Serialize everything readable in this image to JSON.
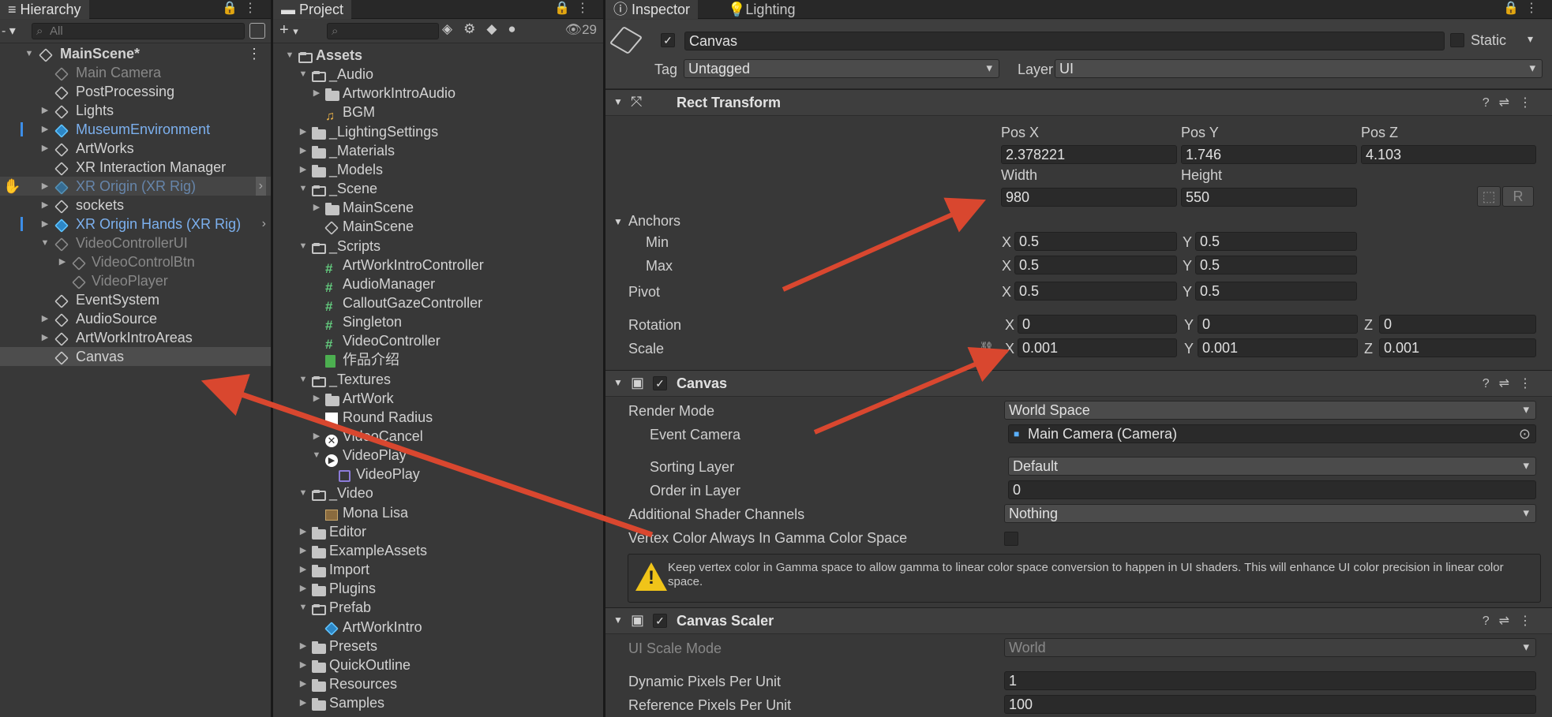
{
  "hierarchy": {
    "tab": "Hierarchy",
    "search_placeholder": "All",
    "scene": "MainScene*",
    "items": [
      "Main Camera",
      "PostProcessing",
      "Lights",
      "MuseumEnvironment",
      "ArtWorks",
      "XR Interaction Manager",
      "XR Origin (XR Rig)",
      "sockets",
      "XR Origin Hands (XR Rig)",
      "VideoControllerUI",
      "VideoControlBtn",
      "VideoPlayer",
      "EventSystem",
      "AudioSource",
      "ArtWorkIntroAreas",
      "Canvas"
    ]
  },
  "project": {
    "tab": "Project",
    "count": "29",
    "items": [
      "Assets",
      "_Audio",
      "ArtworkIntroAudio",
      "BGM",
      "_LightingSettings",
      "_Materials",
      "_Models",
      "_Scene",
      "MainScene",
      "MainScene",
      "_Scripts",
      "ArtWorkIntroController",
      "AudioManager",
      "CalloutGazeController",
      "Singleton",
      "VideoController",
      "作品介绍",
      "_Textures",
      "ArtWork",
      "Round Radius",
      "VideoCancel",
      "VideoPlay",
      "VideoPlay",
      "_Video",
      "Mona Lisa",
      "Editor",
      "ExampleAssets",
      "Import",
      "Plugins",
      "Prefab",
      "ArtWorkIntro",
      "Presets",
      "QuickOutline",
      "Resources",
      "Samples"
    ]
  },
  "inspector": {
    "tabs": [
      "Inspector",
      "Lighting"
    ],
    "object_name": "Canvas",
    "static_label": "Static",
    "tag_label": "Tag",
    "tag_value": "Untagged",
    "layer_label": "Layer",
    "layer_value": "UI",
    "rect": {
      "title": "Rect Transform",
      "posx_label": "Pos X",
      "posy_label": "Pos Y",
      "posz_label": "Pos Z",
      "posx": "2.378221",
      "posy": "1.746",
      "posz": "4.103",
      "width_label": "Width",
      "height_label": "Height",
      "width": "980",
      "height": "550",
      "anchors": "Anchors",
      "min": "Min",
      "max": "Max",
      "pivot": "Pivot",
      "min_x": "0.5",
      "min_y": "0.5",
      "max_x": "0.5",
      "max_y": "0.5",
      "pivot_x": "0.5",
      "pivot_y": "0.5",
      "rotation": "Rotation",
      "rot_x": "0",
      "rot_y": "0",
      "rot_z": "0",
      "scale": "Scale",
      "scale_x": "0.001",
      "scale_y": "0.001",
      "scale_z": "0.001",
      "x": "X",
      "y": "Y",
      "z": "Z",
      "r_btn": "R"
    },
    "canvas": {
      "title": "Canvas",
      "render_mode_label": "Render Mode",
      "render_mode": "World Space",
      "event_camera_label": "Event Camera",
      "event_camera": "Main Camera (Camera)",
      "sorting_layer_label": "Sorting Layer",
      "sorting_layer": "Default",
      "order_label": "Order in Layer",
      "order": "0",
      "shader_label": "Additional Shader Channels",
      "shader": "Nothing",
      "vertex_label": "Vertex Color Always In Gamma Color Space",
      "help": "Keep vertex color in Gamma space to allow gamma to linear color space conversion to happen in UI shaders. This will enhance UI color precision in linear color space."
    },
    "scaler": {
      "title": "Canvas Scaler",
      "mode_label": "UI Scale Mode",
      "mode": "World",
      "dynamic_label": "Dynamic Pixels Per Unit",
      "dynamic": "1",
      "ref_label": "Reference Pixels Per Unit",
      "ref": "100"
    }
  },
  "colors": {
    "annotation_arrow": "#d9472f",
    "selection_blue": "#3d8ee8"
  }
}
